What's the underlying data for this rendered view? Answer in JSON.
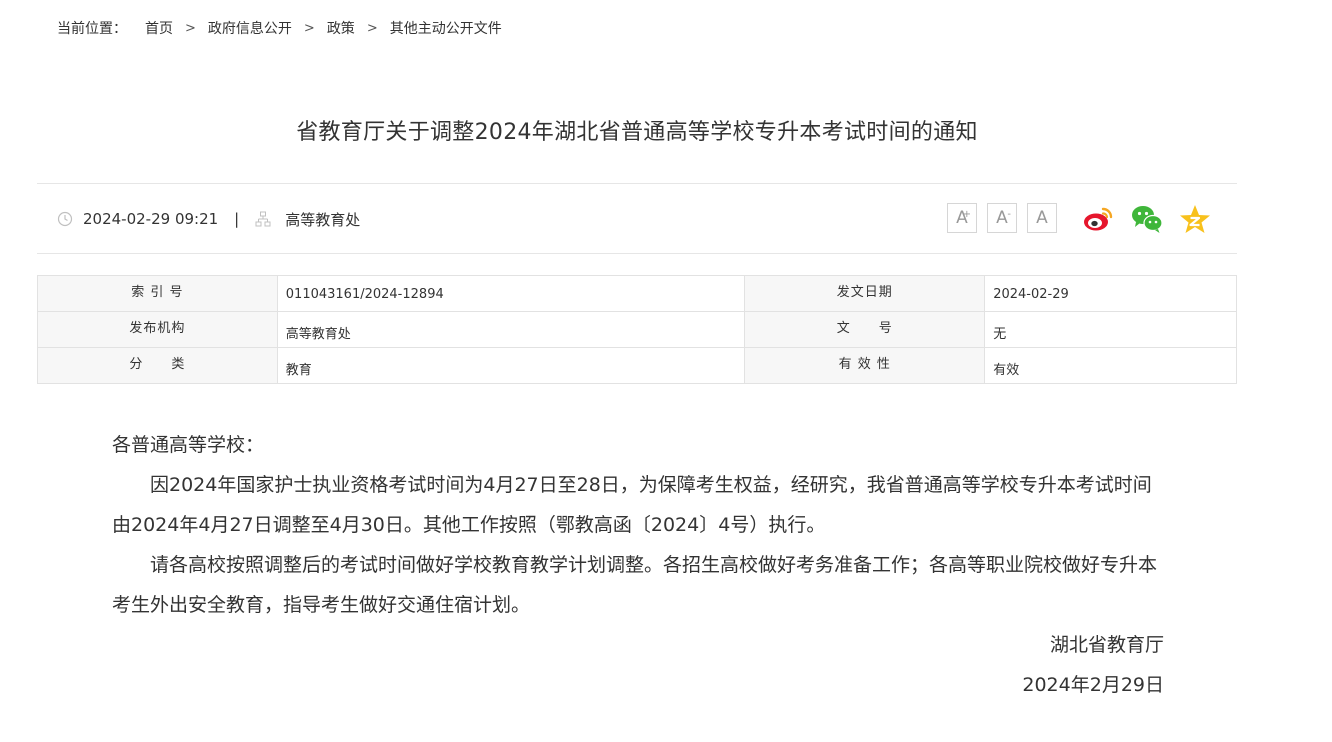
{
  "breadcrumb": {
    "label": "当前位置：",
    "items": [
      "首页",
      "政府信息公开",
      "政策",
      "其他主动公开文件"
    ],
    "separator": ">"
  },
  "article": {
    "title": "省教育厅关于调整2024年湖北省普通高等学校专升本考试时间的通知",
    "date": "2024-02-29 09:21",
    "divider": "|",
    "department": "高等教育处"
  },
  "font_buttons": [
    {
      "letter": "A",
      "mark": "+"
    },
    {
      "letter": "A",
      "mark": "-"
    },
    {
      "letter": "A",
      "mark": ""
    }
  ],
  "info_table": {
    "rows": [
      [
        {
          "key": "索 引 号",
          "value": "011043161/2024-12894"
        },
        {
          "key": "发文日期",
          "value": "2024-02-29"
        }
      ],
      [
        {
          "key": "发布机构",
          "value": "高等教育处"
        },
        {
          "key": "文　　号",
          "value": "无"
        }
      ],
      [
        {
          "key": "分　　类",
          "value": "教育"
        },
        {
          "key": "有 效 性",
          "value": "有效"
        }
      ]
    ]
  },
  "content": {
    "salutation": "各普通高等学校：",
    "paragraphs": [
      "因2024年国家护士执业资格考试时间为4月27日至28日，为保障考生权益，经研究，我省普通高等学校专升本考试时间由2024年4月27日调整至4月30日。其他工作按照（鄂教高函〔2024〕4号）执行。",
      "请各高校按照调整后的考试时间做好学校教育教学计划调整。各招生高校做好考务准备工作；各高等职业院校做好专升本考生外出安全教育，指导考生做好交通住宿计划。"
    ],
    "signature": "湖北省教育厅",
    "sign_date": "2024年2月29日"
  },
  "colors": {
    "weibo": "#e6162d",
    "weibo_orange": "#f5a623",
    "wechat": "#3fb63a",
    "qzone": "#f8c11c"
  }
}
